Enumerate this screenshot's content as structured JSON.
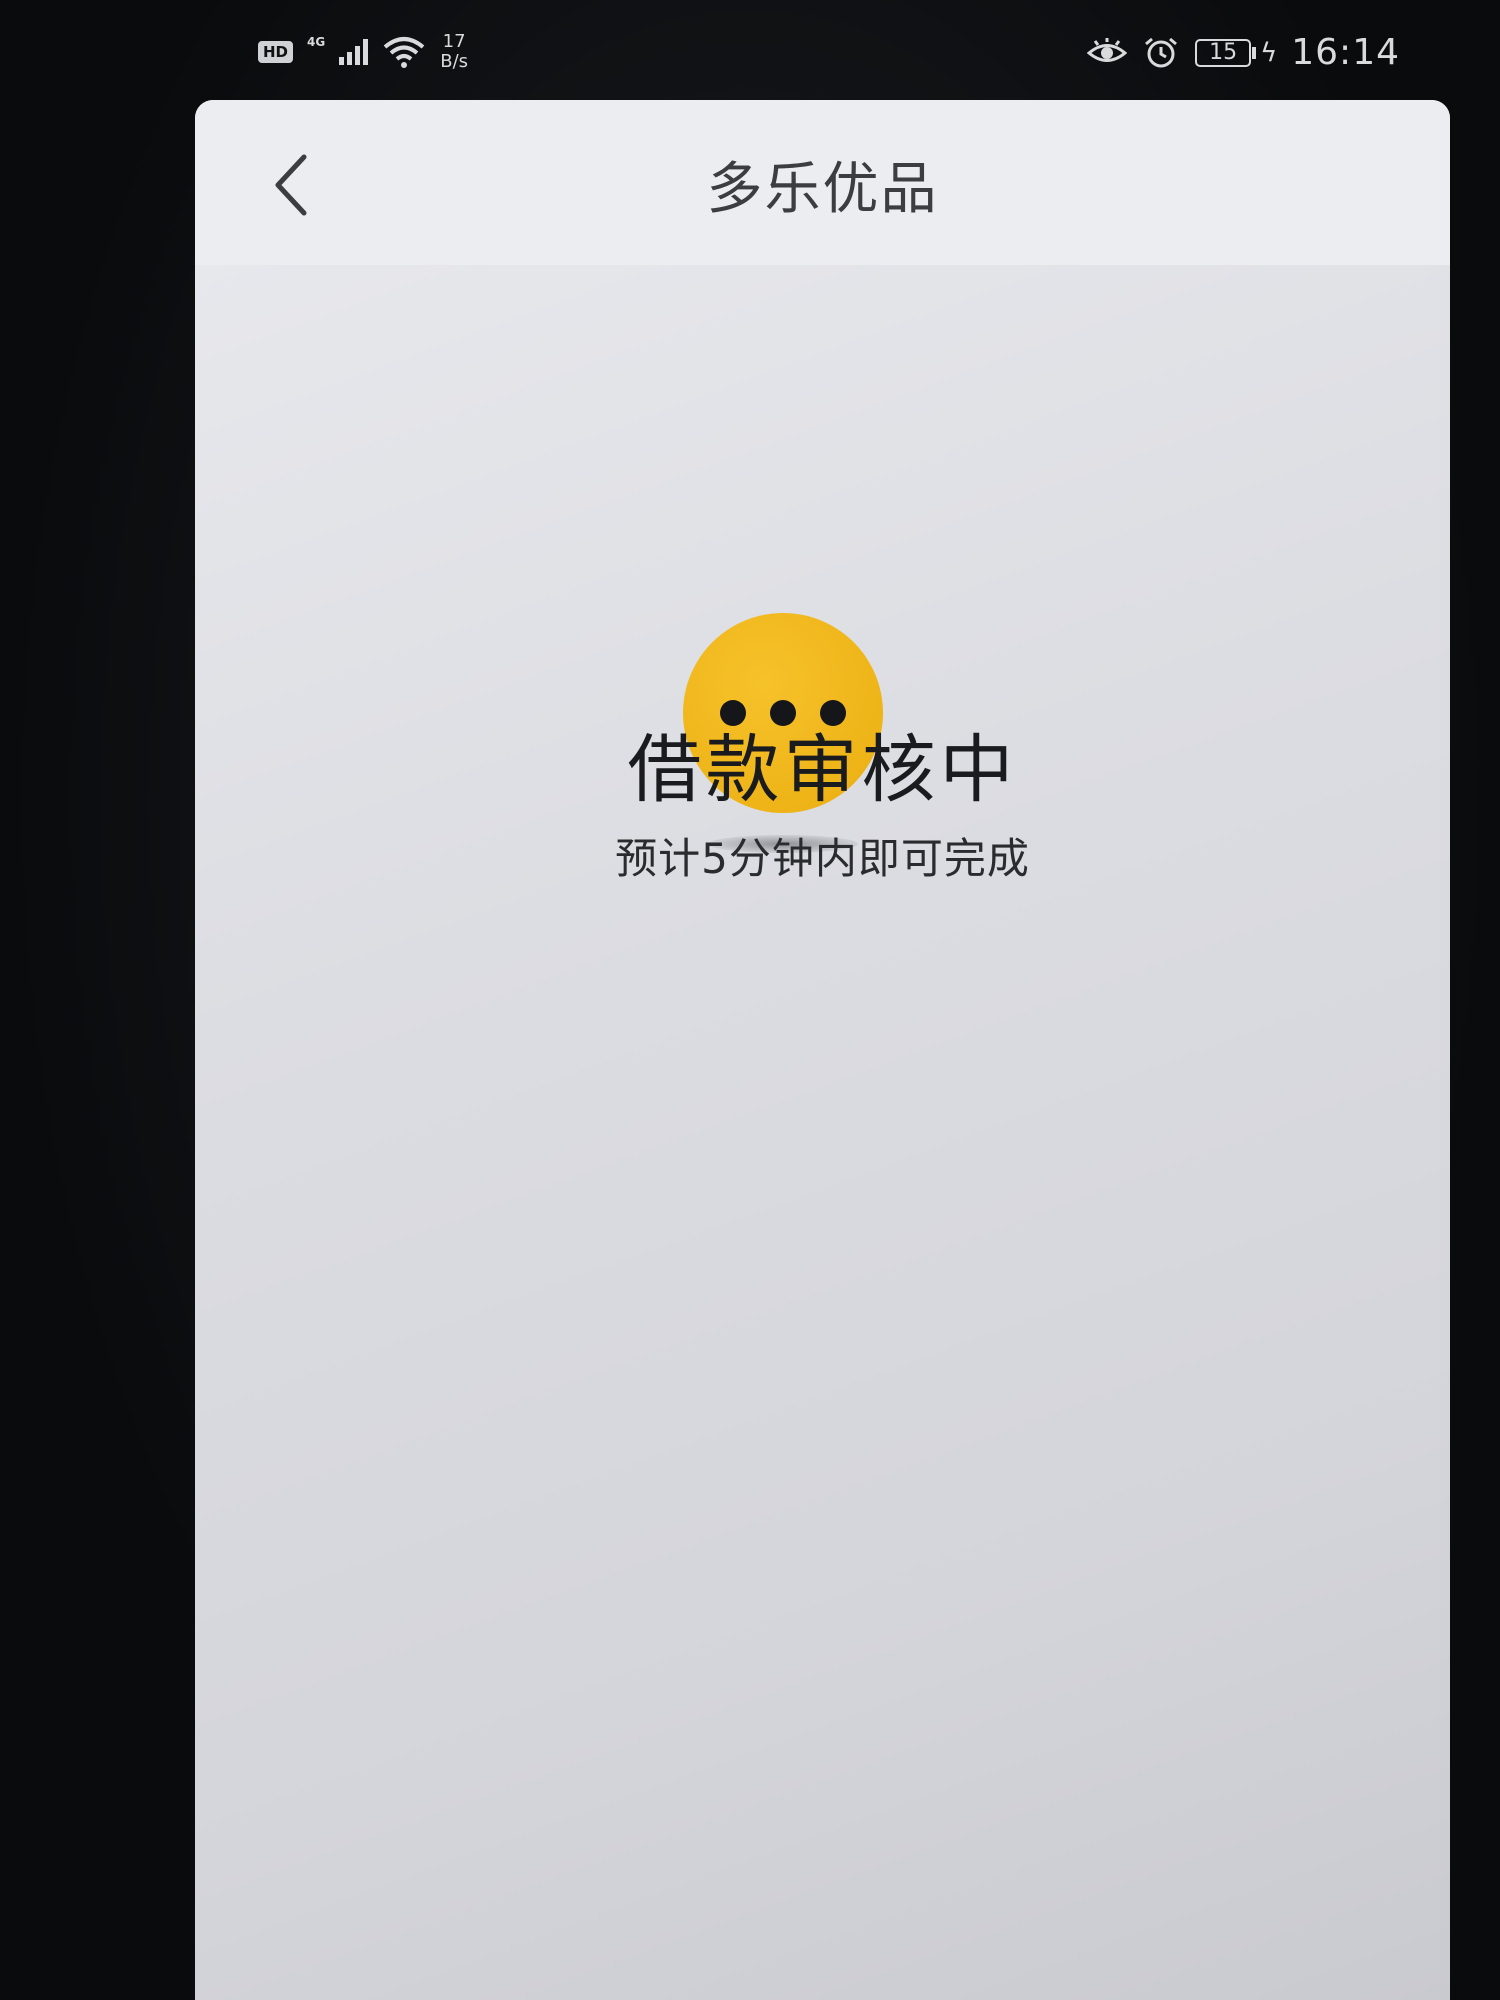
{
  "status_bar": {
    "hd": "HD",
    "network": "4G",
    "speed_value": "17",
    "speed_unit": "B/s",
    "battery": "15",
    "time": "16:14"
  },
  "nav": {
    "title": "多乐优品"
  },
  "status": {
    "title": "借款审核中",
    "subtitle": "预计5分钟内即可完成"
  },
  "colors": {
    "pending_circle": "#f0b81c",
    "screen_bg": "#dcdde2"
  }
}
